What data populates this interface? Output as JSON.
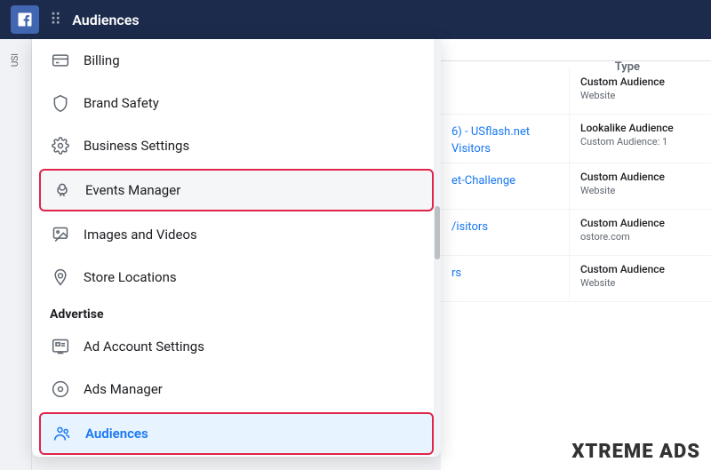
{
  "topNav": {
    "title": "Audiences",
    "fbLogoText": "f"
  },
  "sidebarStrip": {
    "label": "USE"
  },
  "menu": {
    "items": [
      {
        "id": "billing",
        "label": "Billing",
        "icon": "billing"
      },
      {
        "id": "brand-safety",
        "label": "Brand Safety",
        "icon": "shield"
      },
      {
        "id": "business-settings",
        "label": "Business Settings",
        "icon": "gear"
      },
      {
        "id": "events-manager",
        "label": "Events Manager",
        "icon": "events",
        "highlighted": true
      },
      {
        "id": "images-videos",
        "label": "Images and Videos",
        "icon": "image"
      },
      {
        "id": "store-locations",
        "label": "Store Locations",
        "icon": "location"
      }
    ],
    "advertiseSection": {
      "label": "Advertise",
      "items": [
        {
          "id": "ad-account-settings",
          "label": "Ad Account Settings",
          "icon": "ad-account"
        },
        {
          "id": "ads-manager",
          "label": "Ads Manager",
          "icon": "ads-manager"
        },
        {
          "id": "audiences",
          "label": "Audiences",
          "icon": "audiences",
          "active": true
        }
      ]
    }
  },
  "table": {
    "typeHeader": "Type",
    "rows": [
      {
        "link": null,
        "typeName": "Custom Audience",
        "typeSub": "Website"
      },
      {
        "link": "6) - USflash.net Visitors",
        "typeName": "Lookalike Audience",
        "typeSub": "Custom Audience: 1"
      },
      {
        "link": "et-Challenge",
        "typeName": "Custom Audience",
        "typeSub": "Website"
      },
      {
        "link": "/isitors",
        "typeName": "Custom Audience",
        "typeSub": "ostore.com"
      },
      {
        "link": "rs",
        "typeName": "Custom Audience",
        "typeSub": "Website"
      }
    ]
  },
  "watermark": {
    "text1": "XTREME",
    "text2": "ADS"
  }
}
